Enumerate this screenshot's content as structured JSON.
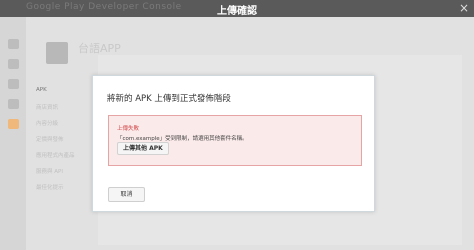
{
  "window": {
    "brand": "Google Play Developer Console",
    "title": "上傳確認",
    "close_label": "×"
  },
  "rail_icons": [
    "android-icon",
    "gamepad-icon",
    "chart-icon",
    "gear-icon",
    "notification-icon"
  ],
  "sidebar": {
    "app_name": "台語APP",
    "items": [
      "APK",
      "商店資訊",
      "內容分級",
      "定價與發佈",
      "應用程式內產品",
      "服務與 API",
      "最佳化提示"
    ]
  },
  "dialog": {
    "title": "將新的 APK 上傳到正式發佈階段",
    "alert_title": "上傳失敗",
    "alert_message": "「com.example」受到限制，請選用其他套件名稱。",
    "upload_other_button": "上傳其他 APK",
    "cancel_button": "取消"
  },
  "colors": {
    "title_bar": "#5a5a5a",
    "alert_bg": "#fbeaea",
    "alert_text": "#d14a4a"
  }
}
